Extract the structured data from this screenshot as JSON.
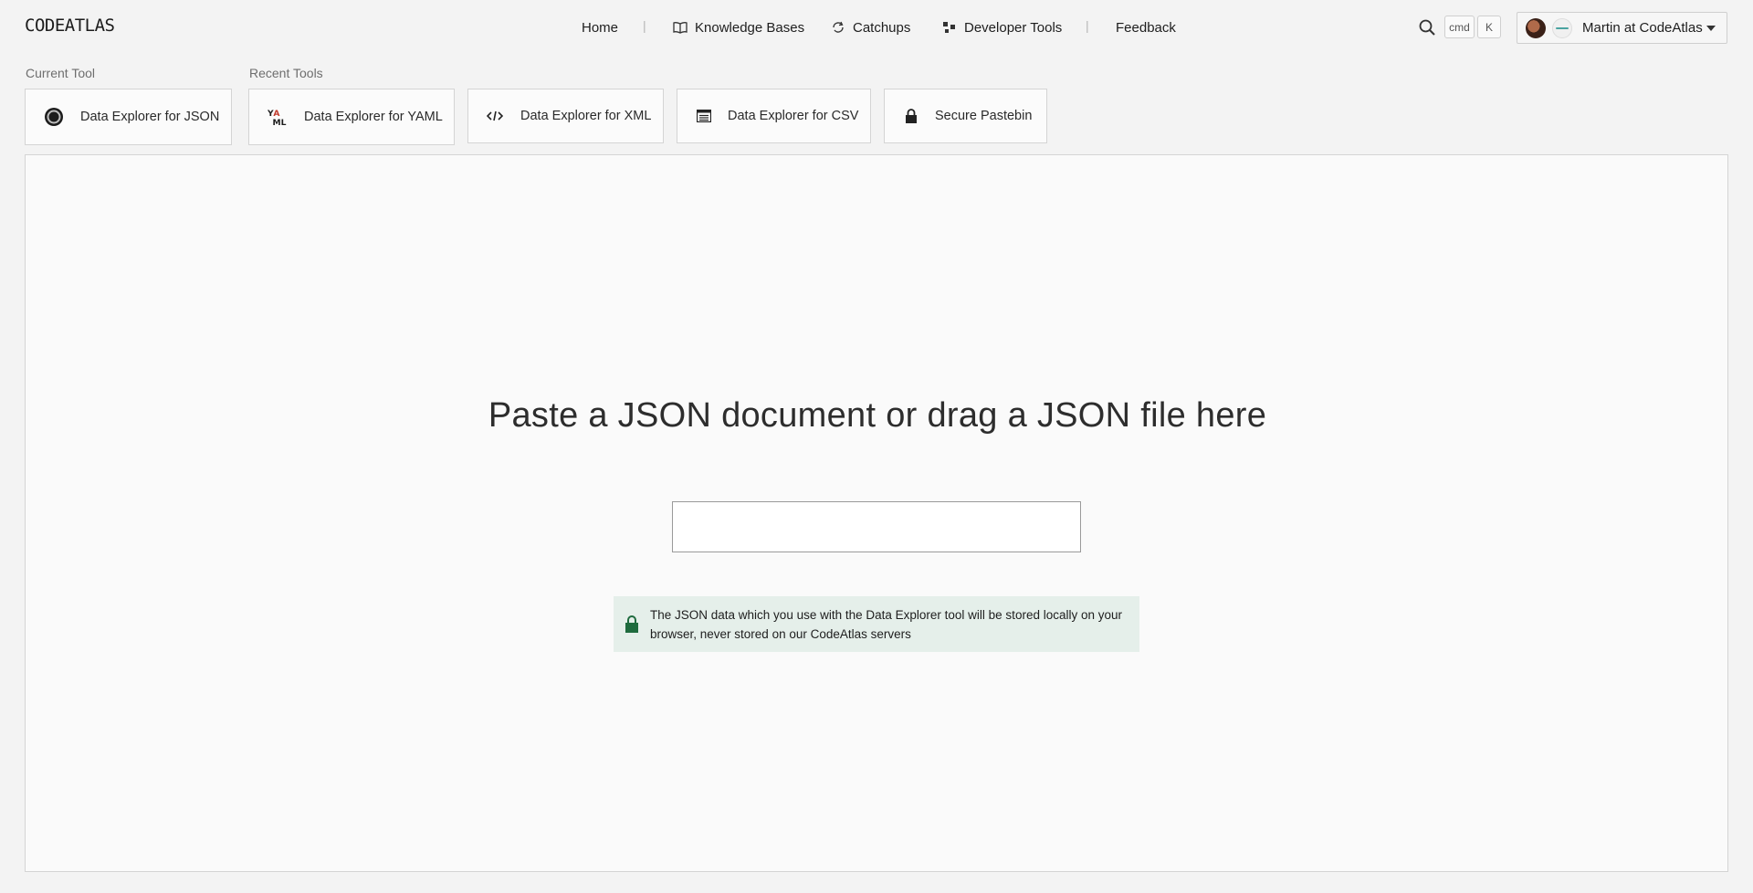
{
  "app": {
    "logo": "CODEATLAS"
  },
  "nav": {
    "home": "Home",
    "knowledge_bases": "Knowledge Bases",
    "catchups": "Catchups",
    "developer_tools": "Developer Tools",
    "feedback": "Feedback",
    "separator": "|"
  },
  "shortcut": {
    "key1": "cmd",
    "key2": "K"
  },
  "account": {
    "label": "Martin at CodeAtlas"
  },
  "tools": {
    "current_label": "Current Tool",
    "recent_label": "Recent Tools",
    "current": {
      "label": "Data Explorer for JSON",
      "icon": "json-icon"
    },
    "recent": [
      {
        "label": "Data Explorer for YAML",
        "icon": "yaml-icon"
      },
      {
        "label": "Data Explorer for XML",
        "icon": "code-icon"
      },
      {
        "label": "Data Explorer for CSV",
        "icon": "table-icon"
      },
      {
        "label": "Secure Pastebin",
        "icon": "lock-icon"
      }
    ]
  },
  "workspace": {
    "heading": "Paste a JSON document or drag a JSON file here",
    "input_value": "",
    "notice": "The JSON data which you use with the Data Explorer tool will be stored locally on your browser, never stored on our CodeAtlas servers"
  },
  "colors": {
    "notice_bg": "#e5efea",
    "lock_green": "#1f6b3e"
  }
}
